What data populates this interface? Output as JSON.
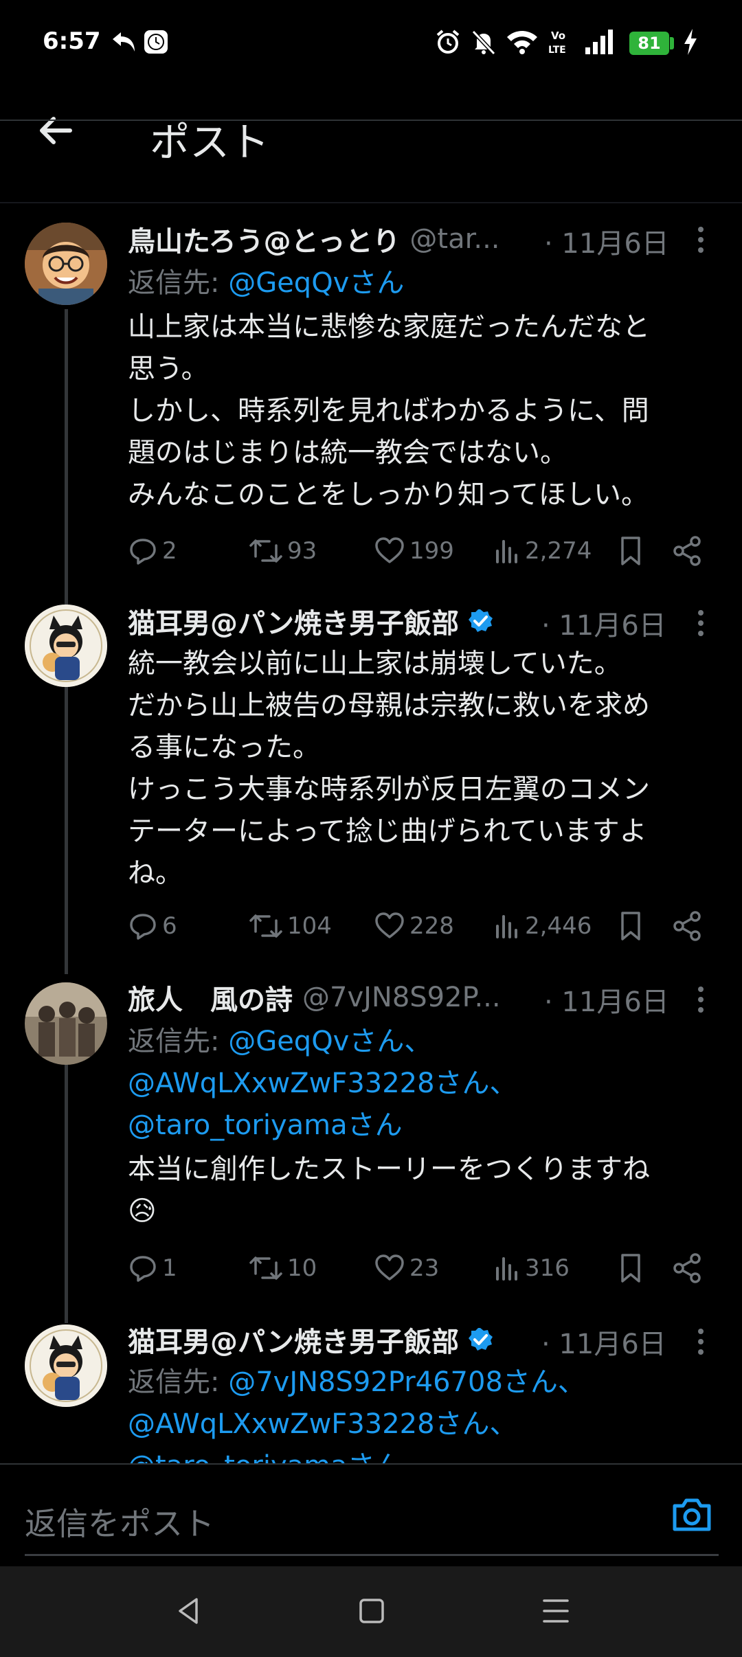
{
  "status_bar": {
    "time": "6:57",
    "battery": "81",
    "icons": [
      "back-arrow-notification-icon",
      "clock-app-icon",
      "alarm-icon",
      "mute-icon",
      "wifi-icon",
      "volte-icon",
      "signal-icon",
      "charging-icon"
    ]
  },
  "header": {
    "title": "ポスト",
    "back_icon": "back-arrow-icon"
  },
  "posts": [
    {
      "name": "鳥山たろう@とっとり",
      "handle": "@tar...",
      "date": "· 11月6日",
      "reply_prefix": "返信先: ",
      "reply_links": [
        "@GeqQvさん"
      ],
      "body": "山上家は本当に悲惨な家庭だったんだなと\n思う。\nしかし、時系列を見ればわかるように、問\n題のはじまりは統一教会ではない。\nみんなこのことをしっかり知ってほしい。",
      "replies": "2",
      "reposts": "93",
      "likes": "199",
      "views": "2,274",
      "verified": false
    },
    {
      "name": "猫耳男@パン焼き男子飯部",
      "handle": "",
      "date": "· 11月6日",
      "reply_prefix": "",
      "reply_links": [],
      "body": "統一教会以前に山上家は崩壊していた。\nだから山上被告の母親は宗教に救いを求め\nる事になった。\nけっこう大事な時系列が反日左翼のコメン\nテーターによって捻じ曲げられていますよ\nね。",
      "replies": "6",
      "reposts": "104",
      "likes": "228",
      "views": "2,446",
      "verified": true
    },
    {
      "name": "旅人　風の詩",
      "handle": "@7vJN8S92P...",
      "date": "· 11月6日",
      "reply_prefix": "返信先: ",
      "reply_links": [
        "@GeqQvさん、",
        "@AWqLXxwZwF33228さん、",
        "@taro_toriyamaさん"
      ],
      "body": "本当に創作したストーリーをつくりますね\n😥",
      "replies": "1",
      "reposts": "10",
      "likes": "23",
      "views": "316",
      "verified": false
    },
    {
      "name": "猫耳男@パン焼き男子飯部",
      "handle": "",
      "date": "· 11月6日",
      "reply_prefix": "返信先: ",
      "reply_links": [
        "@7vJN8S92Pr46708さん、",
        "@AWqLXxwZwF33228さん、",
        "@taro_toriyamaさん"
      ],
      "body": "",
      "verified": true
    }
  ],
  "reply_bar": {
    "placeholder": "返信をポスト",
    "camera_icon": "camera-icon"
  },
  "nav_bar": {
    "icons": [
      "nav-back-icon",
      "nav-home-icon",
      "nav-menu-icon"
    ]
  },
  "colors": {
    "background": "#000000",
    "text": "#e7e9ea",
    "muted": "#71767b",
    "link": "#1d9bf0",
    "battery": "#2fb33a"
  }
}
